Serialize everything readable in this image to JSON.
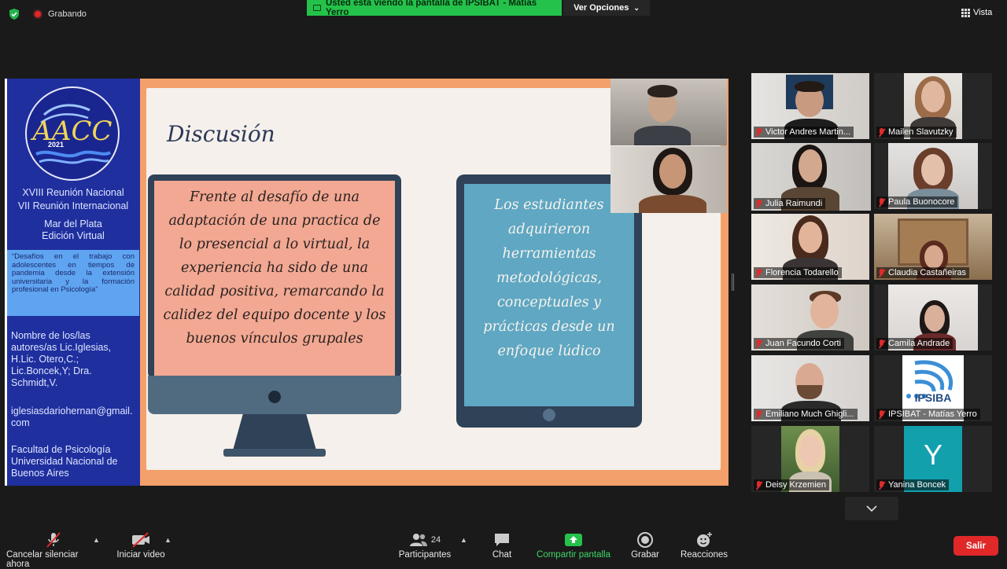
{
  "top": {
    "recording_label": "Grabando",
    "share_banner": "Usted está viendo la pantalla de IPSIBAT - Matías Yerro",
    "view_options": "Ver Opciones",
    "view_label": "Vista"
  },
  "slide": {
    "logo_year": "2021",
    "logo_letters": "AACC",
    "meeting_line1": "XVIII Reunión Nacional",
    "meeting_line2": "VII Reunión Internacional",
    "place_line1": "Mar del Plata",
    "place_line2": "Edición Virtual",
    "abstract": "“Desafíos en el trabajo con adolescentes en tiempos de pandemia desde la extensión universitaria y la formación profesional en Psicología”",
    "authors": "Nombre de los/las autores/as Lic.Iglesias, H.Lic. Otero,C.; Lic.Boncek,Y; Dra. Schmidt,V.",
    "email": "iglesiasdariohernan@gmail.com",
    "faculty": "Facultad de Psicología Universidad Nacional de Buenos Aires",
    "title": "Discusión",
    "monitor_text": "Frente al desafío de una adaptación de una practica de lo presencial a lo virtual, la experiencia ha sido de una calidad positiva, remarcando la calidez del equipo docente y los buenos vínculos grupales",
    "tablet_text": "Los estudiantes adquirieron herramientas metodológicas, conceptuales y prácticas desde un enfoque lúdico"
  },
  "gallery": [
    {
      "name": "Victor Andres Martin...",
      "initial": ""
    },
    {
      "name": "Mailen Slavutzky",
      "initial": ""
    },
    {
      "name": "Julia Raimundi",
      "initial": ""
    },
    {
      "name": "Paula Buonocore",
      "initial": ""
    },
    {
      "name": "Florencia Todarello",
      "initial": ""
    },
    {
      "name": "Claudia Castañeiras",
      "initial": ""
    },
    {
      "name": "Juan Facundo Corti",
      "initial": ""
    },
    {
      "name": "Camila Andrade",
      "initial": ""
    },
    {
      "name": "Emiliano Much Ghigli...",
      "initial": ""
    },
    {
      "name": "IPSIBAT - Matías Yerro",
      "initial": "IPSIBA"
    },
    {
      "name": "Deisy Krzemien",
      "initial": ""
    },
    {
      "name": "Yanina Boncek",
      "initial": "Y"
    }
  ],
  "toolbar": {
    "mute": "Cancelar silenciar ahora",
    "video": "Iniciar video",
    "participants": "Participantes",
    "participants_count": "24",
    "chat": "Chat",
    "share": "Compartir pantalla",
    "record": "Grabar",
    "reactions": "Reacciones",
    "leave": "Salir"
  },
  "colors": {
    "share_green": "#24c24a",
    "leave_red": "#e02828",
    "active_speaker": "#e2e23a"
  }
}
